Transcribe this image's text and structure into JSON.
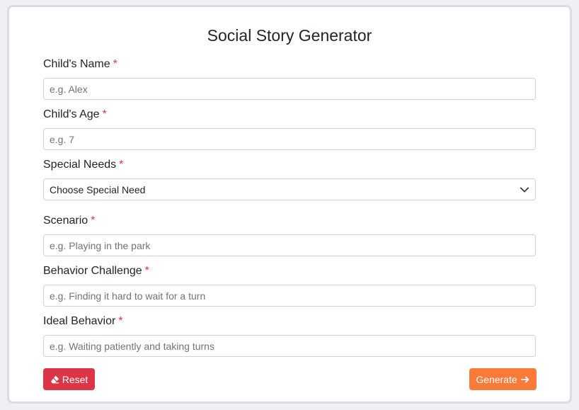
{
  "title": "Social Story Generator",
  "fields": {
    "name": {
      "label": "Child's Name",
      "placeholder": "e.g. Alex",
      "required": "*"
    },
    "age": {
      "label": "Child's Age",
      "placeholder": "e.g. 7",
      "required": "*"
    },
    "needs": {
      "label": "Special Needs",
      "selected": "Choose Special Need",
      "required": "*"
    },
    "scenario": {
      "label": "Scenario",
      "placeholder": "e.g. Playing in the park",
      "required": "*"
    },
    "behavior": {
      "label": "Behavior Challenge",
      "placeholder": "e.g. Finding it hard to wait for a turn",
      "required": "*"
    },
    "ideal": {
      "label": "Ideal Behavior",
      "placeholder": "e.g. Waiting patiently and taking turns",
      "required": "*"
    }
  },
  "buttons": {
    "reset": {
      "label": "Reset",
      "icon": "eraser-icon",
      "color": "#dc3545"
    },
    "generate": {
      "label": "Generate",
      "icon": "arrow-right-icon",
      "color": "#f97a39"
    }
  },
  "colors": {
    "required": "#dc3545"
  }
}
